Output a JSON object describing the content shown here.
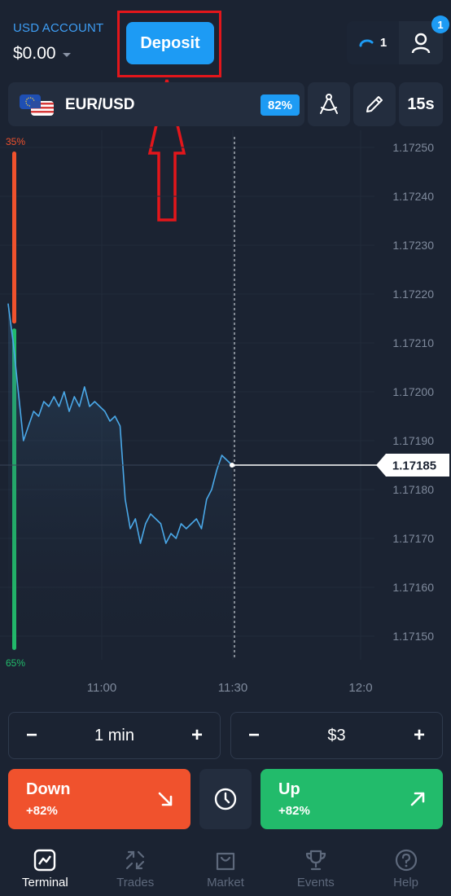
{
  "header": {
    "account_label": "USD ACCOUNT",
    "balance": "$0.00",
    "deposit_label": "Deposit",
    "open_trades_count": "1",
    "notification_count": "1"
  },
  "asset": {
    "pair": "EUR/USD",
    "payout": "82%",
    "timeframe": "15s"
  },
  "chart": {
    "sentiment_down": "35%",
    "sentiment_up": "65%",
    "current_price": "1.17185",
    "price_ticks": [
      "1.17250",
      "1.17240",
      "1.17230",
      "1.17220",
      "1.17210",
      "1.17200",
      "1.17190",
      "1.17180",
      "1.17170",
      "1.17160",
      "1.17150"
    ],
    "time_ticks": [
      "11:00",
      "11:30",
      "12:0"
    ],
    "colors": {
      "line": "#4aa8e8",
      "down": "#f0522d",
      "up": "#22bb6b",
      "accent": "#1d9bf4"
    }
  },
  "chart_data": {
    "type": "line",
    "x": [
      "10:46",
      "10:47",
      "10:48",
      "10:49",
      "10:50",
      "10:51",
      "10:52",
      "10:53",
      "10:54",
      "10:55",
      "10:56",
      "10:57",
      "10:58",
      "10:59",
      "11:00",
      "11:01",
      "11:02",
      "11:03",
      "11:04",
      "11:05",
      "11:06",
      "11:07",
      "11:08",
      "11:09",
      "11:10",
      "11:11",
      "11:12",
      "11:13",
      "11:14",
      "11:15",
      "11:16",
      "11:17",
      "11:18",
      "11:19",
      "11:20",
      "11:21",
      "11:22",
      "11:23",
      "11:24",
      "11:25",
      "11:26",
      "11:27",
      "11:28",
      "11:29",
      "11:30"
    ],
    "series": [
      {
        "values": [
          1.17218,
          1.1721,
          1.172,
          1.1719,
          1.17193,
          1.17196,
          1.17195,
          1.17198,
          1.17197,
          1.17199,
          1.17197,
          1.172,
          1.17196,
          1.17199,
          1.17197,
          1.17201,
          1.17197,
          1.17198,
          1.17197,
          1.17196,
          1.17194,
          1.17195,
          1.17193,
          1.17178,
          1.17172,
          1.17174,
          1.17169,
          1.17173,
          1.17175,
          1.17174,
          1.17173,
          1.17169,
          1.17171,
          1.1717,
          1.17173,
          1.17172,
          1.17173,
          1.17174,
          1.17172,
          1.17178,
          1.1718,
          1.17184,
          1.17187,
          1.17186,
          1.17185
        ]
      }
    ],
    "ylim": [
      1.17145,
      1.17253
    ],
    "current_value": 1.17185
  },
  "trade": {
    "duration": "1 min",
    "amount": "$3",
    "minus": "−",
    "plus": "+",
    "down_label": "Down",
    "down_payout": "+82%",
    "up_label": "Up",
    "up_payout": "+82%"
  },
  "nav": {
    "items": [
      {
        "label": "Terminal",
        "icon": "chart-icon"
      },
      {
        "label": "Trades",
        "icon": "trades-arrows-icon"
      },
      {
        "label": "Market",
        "icon": "shopping-bag-icon"
      },
      {
        "label": "Events",
        "icon": "trophy-icon"
      },
      {
        "label": "Help",
        "icon": "help-icon"
      }
    ]
  }
}
